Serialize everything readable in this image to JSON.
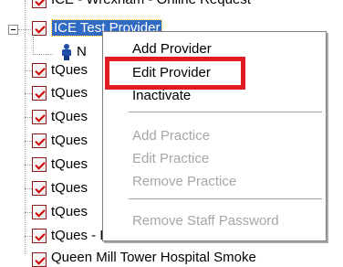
{
  "tree": {
    "top_item_label": "ICE - Wrexham - Online Request",
    "selected_item_label": "ICE Test Provider",
    "child_item_label": "N",
    "items": [
      {
        "label": "tQues"
      },
      {
        "label": "tQues"
      },
      {
        "label": "tQues"
      },
      {
        "label": "tQues"
      },
      {
        "label": "tQues"
      },
      {
        "label": "tQues"
      },
      {
        "label": "tQues"
      },
      {
        "label": "tQues - Lewisham - Online Request"
      }
    ],
    "bottom_item_label": "Queen Mill Tower Hospital Smoke"
  },
  "context_menu": {
    "items": [
      {
        "label": "Add Provider",
        "enabled": true
      },
      {
        "label": "Edit Provider",
        "enabled": true
      },
      {
        "label": "Inactivate",
        "enabled": true
      },
      {
        "label": "Add Practice",
        "enabled": false
      },
      {
        "label": "Edit Practice",
        "enabled": false
      },
      {
        "label": "Remove Practice",
        "enabled": false
      },
      {
        "label": "Remove Staff Password",
        "enabled": false
      }
    ]
  },
  "colors": {
    "selection": "#316ac5",
    "highlight_outline": "#e11b22",
    "disabled_text": "#a6a6a6"
  },
  "icons": {
    "expander": "minus-box-icon",
    "node": "red-check-icon",
    "person": "person-icon"
  }
}
